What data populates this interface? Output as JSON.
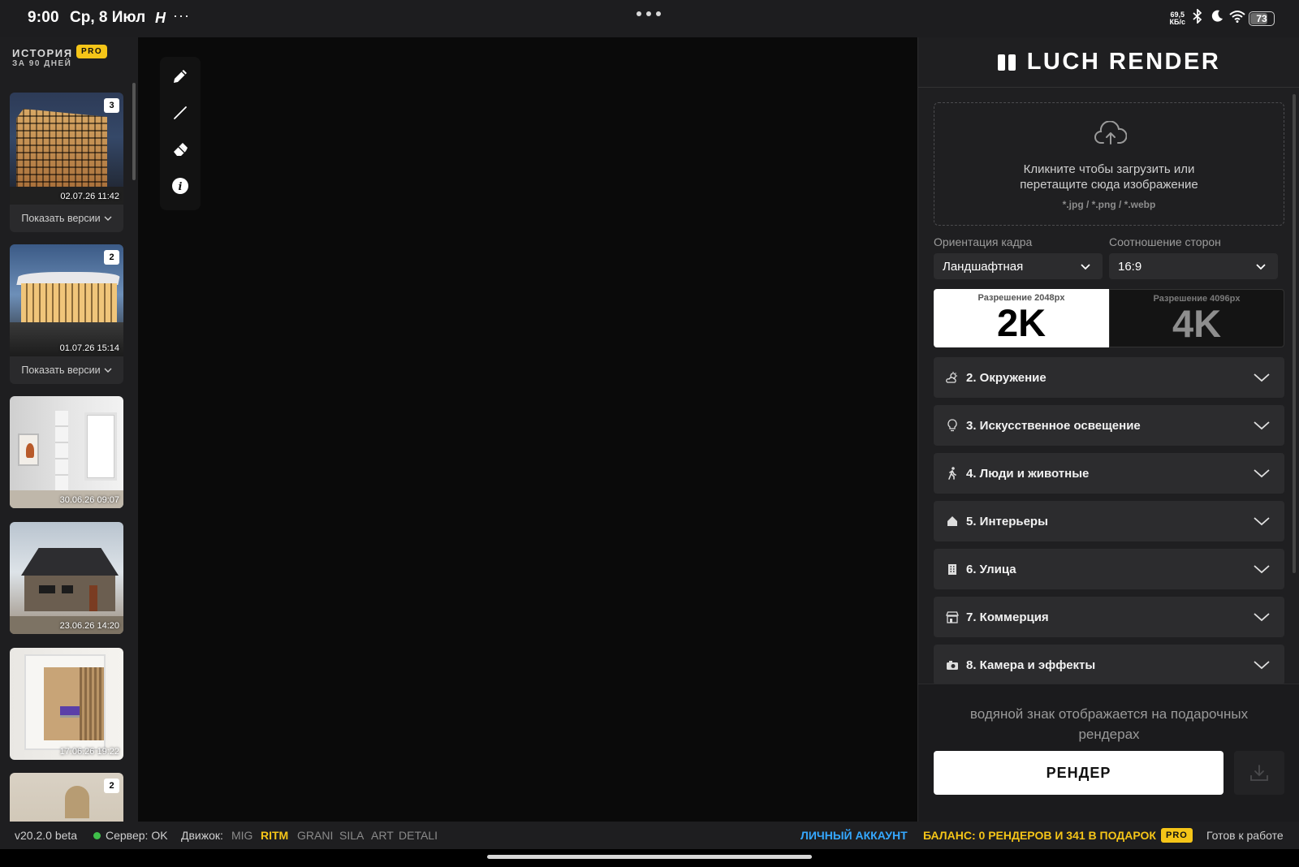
{
  "status_bar": {
    "time": "9:00",
    "date": "Ср, 8 Июл",
    "app_glyph": "H",
    "more": "···",
    "speed_value": "69,5",
    "speed_unit": "КБ/с",
    "battery": "73",
    "icons": [
      "bluetooth-icon",
      "moon-icon",
      "wifi-icon",
      "battery-icon"
    ]
  },
  "history": {
    "title": "ИСТОРИЯ",
    "subtitle": "ЗА 90 ДНЕЙ",
    "badge": "PRO",
    "show_versions": "Показать версии",
    "items": [
      {
        "timestamp": "02.07.26 11:42",
        "count": "3"
      },
      {
        "timestamp": "01.07.26 15:14",
        "count": "2"
      },
      {
        "timestamp": "30.06.26 09:07"
      },
      {
        "timestamp": "23.06.26 14:20"
      },
      {
        "timestamp": "17.06.26 19:22"
      },
      {
        "count": "2"
      }
    ]
  },
  "toolbar": {
    "tools": [
      "pencil-icon",
      "line-icon",
      "eraser-icon",
      "info-icon"
    ]
  },
  "panel": {
    "brand": "LUCH RENDER",
    "upload": {
      "text_line1": "Кликните чтобы загрузить или",
      "text_line2": "перетащите сюда изображение",
      "hint": "*.jpg / *.png / *.webp"
    },
    "orientation": {
      "label": "Ориентация кадра",
      "value": "Ландшафтная"
    },
    "aspect": {
      "label": "Соотношение сторон",
      "value": "16:9"
    },
    "resolution": {
      "option_2k": {
        "caption": "Разрешение 2048px",
        "label": "2K",
        "selected": true
      },
      "option_4k": {
        "caption": "Разрешение 4096px",
        "label": "4K",
        "selected": false
      }
    },
    "sections": [
      {
        "title": "2. Окружение",
        "icon": "weather-icon"
      },
      {
        "title": "3. Искусственное освещение",
        "icon": "lightbulb-icon"
      },
      {
        "title": "4. Люди и животные",
        "icon": "walking-person-icon"
      },
      {
        "title": "5. Интерьеры",
        "icon": "home-icon"
      },
      {
        "title": "6. Улица",
        "icon": "building-icon"
      },
      {
        "title": "7. Коммерция",
        "icon": "store-icon"
      },
      {
        "title": "8. Камера и эффекты",
        "icon": "camera-icon"
      }
    ],
    "watermark_line1": "водяной знак отображается на подарочных",
    "watermark_line2": "рендерах",
    "render_button": "РЕНДЕР"
  },
  "footer": {
    "version": "v20.2.0 beta",
    "server": "Сервер: OK",
    "engine_label": "Движок:",
    "engines": [
      {
        "name": "MIG",
        "active": false
      },
      {
        "name": "RITM",
        "active": true
      },
      {
        "name": "GRANI",
        "active": false
      },
      {
        "name": "SILA",
        "active": false
      },
      {
        "name": "ART",
        "active": false
      },
      {
        "name": "DETALI",
        "active": false
      }
    ],
    "account": "ЛИЧНЫЙ АККАУНТ",
    "balance": "БАЛАНС: 0 РЕНДЕРОВ И 341 В ПОДАРОК",
    "badge": "PRO",
    "status": "Готов к работе"
  },
  "colors": {
    "accent_yellow": "#f5c518",
    "link_blue": "#35a8ff",
    "server_ok": "#3fbf4a",
    "panel_bg": "#1f1f21",
    "canvas_bg": "#0a0a0a"
  }
}
